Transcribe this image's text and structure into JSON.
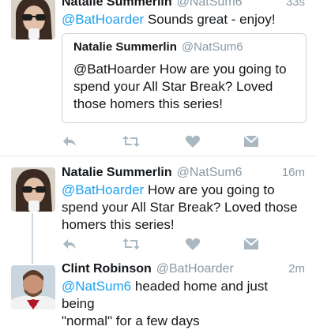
{
  "tweets": [
    {
      "name": "Natalie Summerlin",
      "handle": "@NatSum6",
      "time": "33s",
      "mention": "@BatHoarder",
      "text": "Sounds great - enjoy!",
      "quote": {
        "name": "Natalie Summerlin",
        "handle": "@NatSum6",
        "text": "@BatHoarder How are you going to spend your All Star Break? Loved those homers this series!"
      }
    },
    {
      "name": "Natalie Summerlin",
      "handle": "@NatSum6",
      "time": "16m",
      "mention": "@BatHoarder",
      "text_line1": "How are you going to",
      "text_line2": "spend your All Star Break? Loved those",
      "text_line3": "homers this series!"
    },
    {
      "name": "Clint Robinson",
      "handle": "@BatHoarder",
      "time": "2m",
      "mention": "@NatSum6",
      "text_line1": "headed home and just being",
      "text_line2": "\"normal\" for a few days"
    }
  ],
  "icons": [
    "reply-icon",
    "retweet-icon",
    "like-icon",
    "direct-message-icon"
  ],
  "colors": {
    "link": "#1da1f2",
    "muted": "#8899a6",
    "icon": "#aab8c2"
  }
}
